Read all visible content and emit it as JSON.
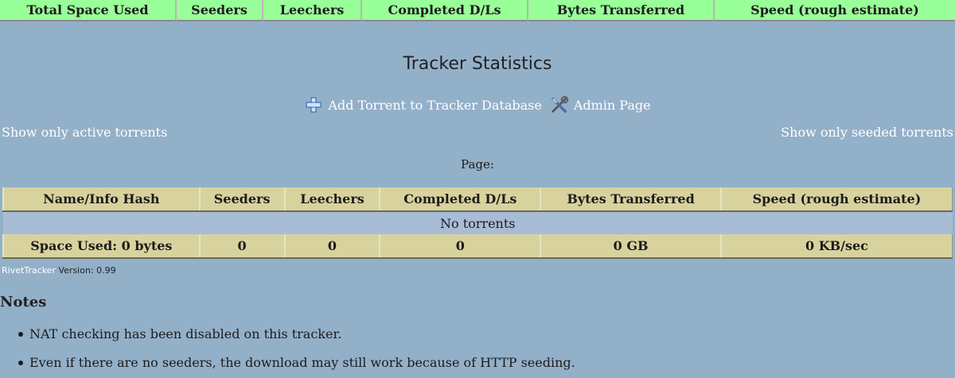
{
  "top_header": {
    "columns": [
      "Total Space Used",
      "Seeders",
      "Leechers",
      "Completed D/Ls",
      "Bytes Transferred",
      "Speed (rough estimate)"
    ]
  },
  "page_title": "Tracker Statistics",
  "actions": {
    "add_torrent": {
      "label": "Add Torrent to Tracker Database",
      "icon": "plus-icon"
    },
    "admin_page": {
      "label": "Admin Page",
      "icon": "tools-icon"
    }
  },
  "filters": {
    "left": "Show only active torrents",
    "right": "Show only seeded torrents"
  },
  "pager": {
    "label": "Page:"
  },
  "table": {
    "headers": [
      "Name/Info Hash",
      "Seeders",
      "Leechers",
      "Completed D/Ls",
      "Bytes Transferred",
      "Speed (rough estimate)"
    ],
    "empty_message": "No torrents",
    "totals": [
      "Space Used: 0 bytes",
      "0",
      "0",
      "0",
      "0 GB",
      "0 KB/sec"
    ]
  },
  "footer": {
    "brand": "RivetTracker",
    "version_text": " Version: 0.99"
  },
  "notes": {
    "heading": "Notes",
    "items": [
      "NAT checking has been disabled on this tracker.",
      "Even if there are no seeders, the download may still work because of HTTP seeding."
    ]
  },
  "colors": {
    "background": "#93b0c9",
    "header_green": "#99ff99",
    "table_header": "#d8d29e",
    "empty_row": "#a8bcd6",
    "link_text": "#ffffff"
  }
}
